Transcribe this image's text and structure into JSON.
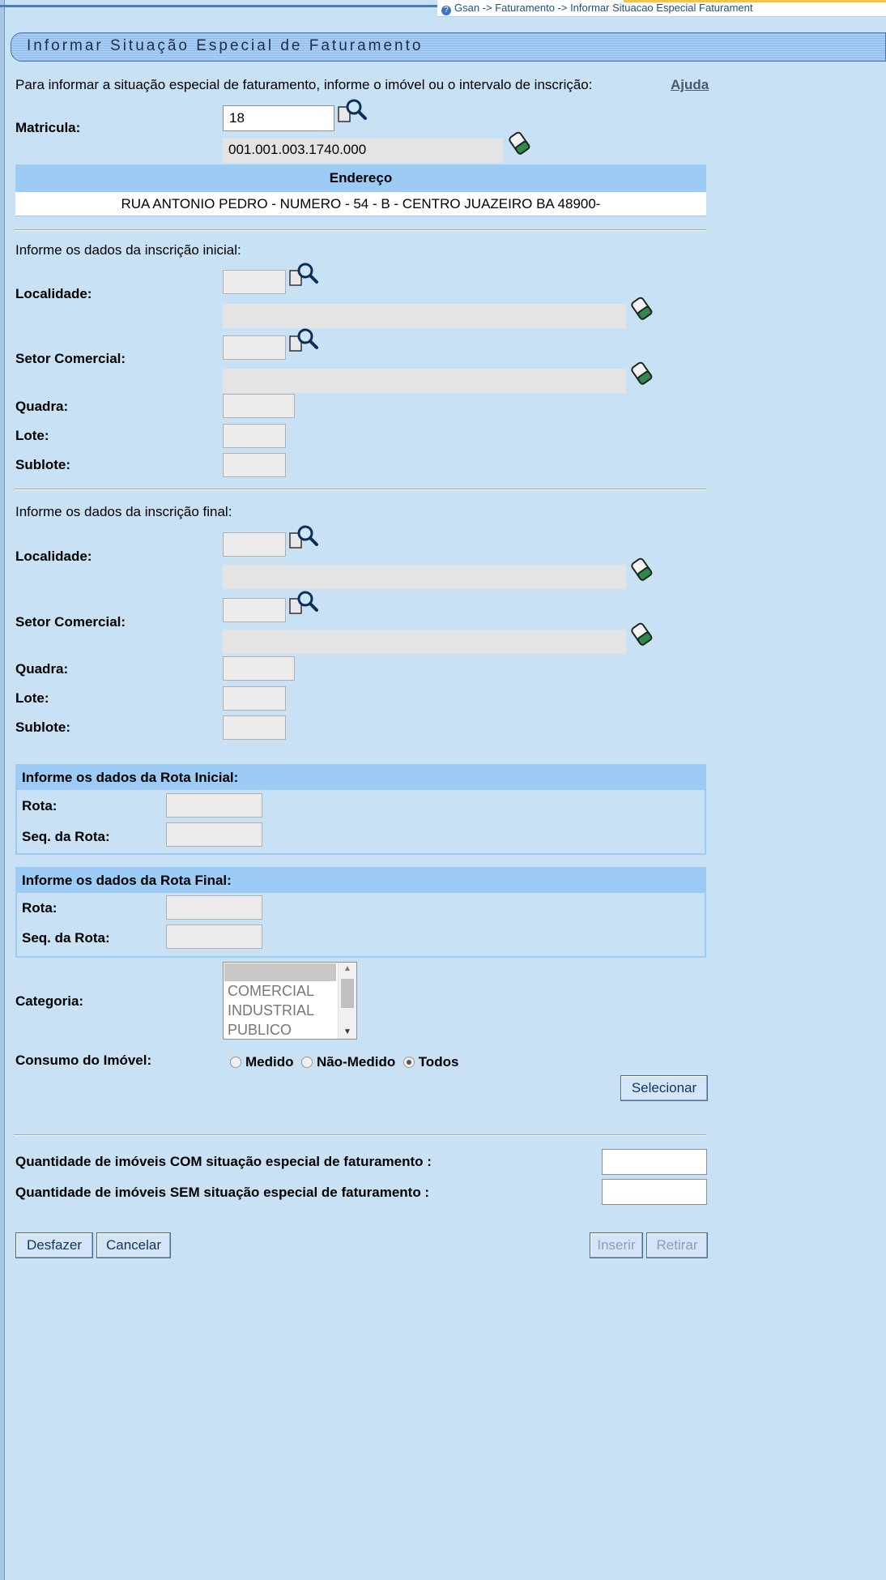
{
  "breadcrumb": "Gsan -> Faturamento -> Informar Situacao Especial Faturament",
  "title": "Informar Situação Especial de Faturamento",
  "intro": "Para informar a situação especial de faturamento, informe o imóvel ou o intervalo de inscrição:",
  "help_link": "Ajuda",
  "matricula": {
    "label": "Matricula:",
    "value": "18",
    "inscricao": "001.001.003.1740.000"
  },
  "endereco": {
    "header": "Endereço",
    "value": "RUA ANTONIO PEDRO - NUMERO - 54   - B - CENTRO JUAZEIRO BA 48900-"
  },
  "inscricao_inicial": {
    "heading": "Informe os dados da inscrição inicial:",
    "localidade_label": "Localidade:",
    "setor_label": "Setor Comercial:",
    "quadra_label": "Quadra:",
    "lote_label": "Lote:",
    "sublote_label": "Sublote:"
  },
  "inscricao_final": {
    "heading": "Informe os dados da inscrição final:",
    "localidade_label": "Localidade:",
    "setor_label": "Setor Comercial:",
    "quadra_label": "Quadra:",
    "lote_label": "Lote:",
    "sublote_label": "Sublote:"
  },
  "rota_inicial": {
    "heading": "Informe os dados da Rota Inicial:",
    "rota_label": "Rota:",
    "seq_label": "Seq. da Rota:"
  },
  "rota_final": {
    "heading": "Informe os dados da Rota Final:",
    "rota_label": "Rota:",
    "seq_label": "Seq. da Rota:"
  },
  "categoria": {
    "label": "Categoria:",
    "options": [
      "",
      "COMERCIAL",
      "INDUSTRIAL",
      "PUBLICO"
    ]
  },
  "consumo": {
    "label": "Consumo do Imóvel:",
    "options": [
      "Medido",
      "Não-Medido",
      "Todos"
    ],
    "selected": "Todos"
  },
  "buttons": {
    "selecionar": "Selecionar",
    "desfazer": "Desfazer",
    "cancelar": "Cancelar",
    "inserir": "Inserir",
    "retirar": "Retirar"
  },
  "quantidades": {
    "com_label": "Quantidade de imóveis COM situação especial de faturamento :",
    "sem_label": "Quantidade de imóveis SEM situação especial de faturamento :",
    "com_value": "",
    "sem_value": ""
  },
  "icons": {
    "search": "magnifier-search-icon",
    "clear": "eraser-icon",
    "help": "help-icon"
  },
  "colors": {
    "background": "#c9e1f5",
    "header": "#9ccbf5",
    "title_bar": "#a9ccf3"
  }
}
